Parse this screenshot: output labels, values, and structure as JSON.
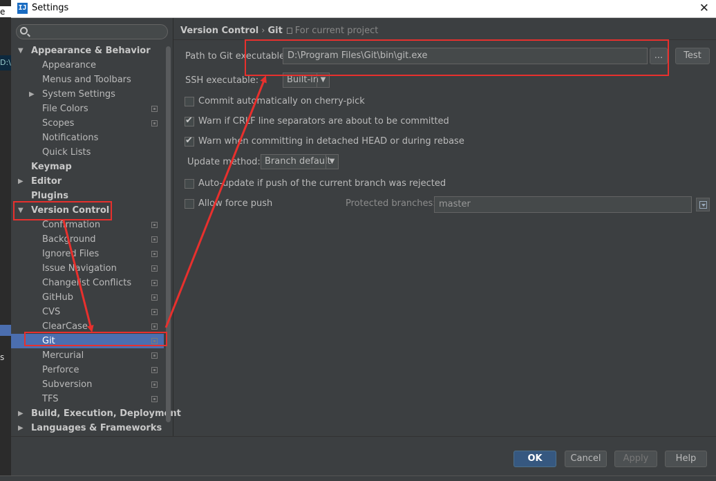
{
  "window": {
    "title": "Settings",
    "app_icon": "IJ"
  },
  "search": {
    "value": ""
  },
  "tree": [
    {
      "label": "Appearance & Behavior",
      "bold": true,
      "level": 0,
      "arrow": "expanded",
      "cfg": false
    },
    {
      "label": "Appearance",
      "level": 1,
      "cfg": false
    },
    {
      "label": "Menus and Toolbars",
      "level": 1,
      "cfg": false
    },
    {
      "label": "System Settings",
      "level": 1,
      "arrow": "collapsed",
      "cfg": false
    },
    {
      "label": "File Colors",
      "level": 1,
      "cfg": true
    },
    {
      "label": "Scopes",
      "level": 1,
      "cfg": true
    },
    {
      "label": "Notifications",
      "level": 1,
      "cfg": false
    },
    {
      "label": "Quick Lists",
      "level": 1,
      "cfg": false
    },
    {
      "label": "Keymap",
      "bold": true,
      "level": 0,
      "cfg": false
    },
    {
      "label": "Editor",
      "bold": true,
      "level": 0,
      "arrow": "collapsed",
      "cfg": false
    },
    {
      "label": "Plugins",
      "bold": true,
      "level": 0,
      "cfg": false
    },
    {
      "label": "Version Control",
      "bold": true,
      "level": 0,
      "arrow": "expanded",
      "cfg": false
    },
    {
      "label": "Confirmation",
      "level": 1,
      "cfg": true
    },
    {
      "label": "Background",
      "level": 1,
      "cfg": true
    },
    {
      "label": "Ignored Files",
      "level": 1,
      "cfg": true
    },
    {
      "label": "Issue Navigation",
      "level": 1,
      "cfg": true
    },
    {
      "label": "Changelist Conflicts",
      "level": 1,
      "cfg": true
    },
    {
      "label": "GitHub",
      "level": 1,
      "cfg": true
    },
    {
      "label": "CVS",
      "level": 1,
      "cfg": true
    },
    {
      "label": "ClearCase",
      "level": 1,
      "cfg": true
    },
    {
      "label": "Git",
      "level": 1,
      "cfg": true,
      "selected": true
    },
    {
      "label": "Mercurial",
      "level": 1,
      "cfg": true
    },
    {
      "label": "Perforce",
      "level": 1,
      "cfg": true
    },
    {
      "label": "Subversion",
      "level": 1,
      "cfg": true
    },
    {
      "label": "TFS",
      "level": 1,
      "cfg": true
    },
    {
      "label": "Build, Execution, Deployment",
      "bold": true,
      "level": 0,
      "arrow": "collapsed",
      "cfg": false
    },
    {
      "label": "Languages & Frameworks",
      "bold": true,
      "level": 0,
      "arrow": "collapsed",
      "cfg": false
    }
  ],
  "breadcrumb": {
    "parent": "Version Control",
    "separator": "›",
    "current": "Git",
    "scope": "For current project"
  },
  "git": {
    "path_label": "Path to Git executable:",
    "path_value": "D:\\Program Files\\Git\\bin\\git.exe",
    "browse_label": "...",
    "test_label": "Test",
    "ssh_label": "SSH executable:",
    "ssh_value": "Built-in",
    "options": [
      {
        "label": "Commit automatically on cherry-pick",
        "checked": false
      },
      {
        "label": "Warn if CRLF line separators are about to be committed",
        "checked": true
      },
      {
        "label": "Warn when committing in detached HEAD or during rebase",
        "checked": true
      }
    ],
    "update_label": "Update method:",
    "update_value": "Branch default",
    "auto_update_label": "Auto-update if push of the current branch was rejected",
    "auto_update_checked": false,
    "force_push_label": "Allow force push",
    "force_push_checked": false,
    "protected_label": "Protected branches:",
    "protected_value": "master"
  },
  "buttons": {
    "ok": "OK",
    "cancel": "Cancel",
    "apply": "Apply",
    "help": "Help"
  },
  "background_app": {
    "fragment_top": "e",
    "fragment_path": "D:\\",
    "fragment_s": "s"
  },
  "colors": {
    "selection": "#4b6eaf",
    "annotation": "#e8302d",
    "ok_button": "#365880"
  }
}
